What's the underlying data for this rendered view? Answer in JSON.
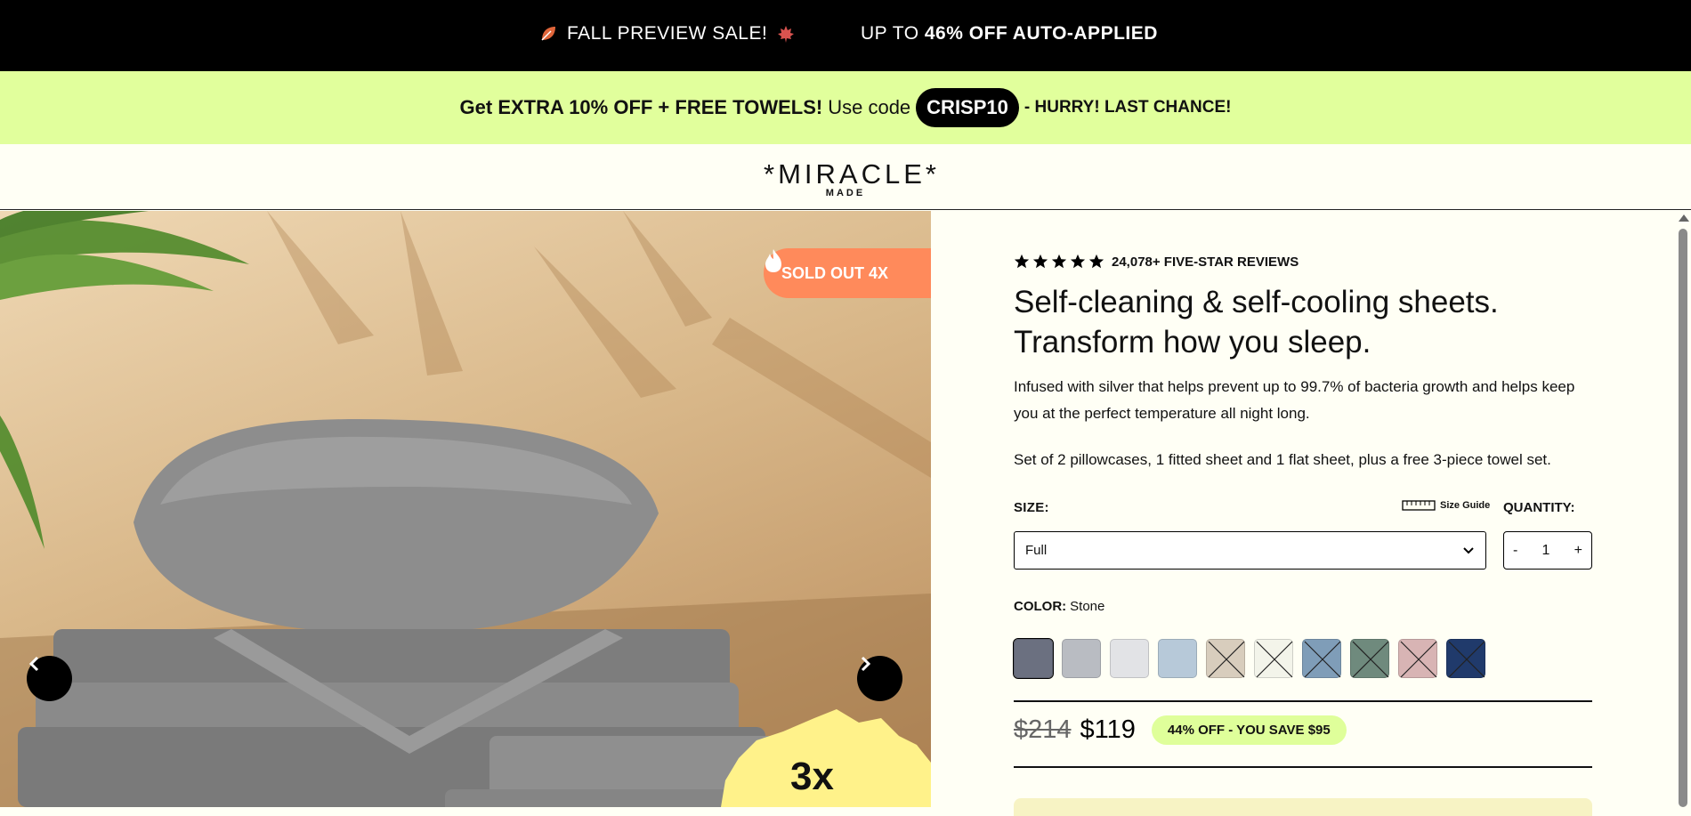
{
  "topbar": {
    "sale_text": "FALL PREVIEW SALE!",
    "up_to": "UP TO",
    "discount": "46% OFF AUTO-APPLIED"
  },
  "promo": {
    "part1": "Get EXTRA 10% OFF + FREE TOWELS!",
    "part2": "Use code",
    "code": "CRISP10",
    "part3": "- HURRY! LAST CHANCE!"
  },
  "brand": {
    "name": "*MIRACLE*",
    "sub": "MADE"
  },
  "gallery": {
    "badge": "SOLD OUT 4X",
    "sticker": "3x"
  },
  "product": {
    "reviews": "24,078+ FIVE-STAR REVIEWS",
    "title_line1": "Self-cleaning & self-cooling sheets.",
    "title_line2": "Transform how you sleep.",
    "description": "Infused with silver that helps prevent up to 99.7% of bacteria growth and helps keep you at the perfect temperature all night long.",
    "set": "Set of 2 pillowcases, 1 fitted sheet and 1 flat sheet, plus a free 3-piece towel set.",
    "size_label": "SIZE:",
    "size_guide": "Size Guide",
    "qty_label": "QUANTITY:",
    "size_value": "Full",
    "qty_minus": "-",
    "qty_value": "1",
    "qty_plus": "+",
    "color_label": "COLOR:",
    "color_value": "Stone",
    "old_price": "$214",
    "new_price": "$119",
    "save": "44% OFF - YOU SAVE $95"
  },
  "swatches": [
    {
      "color": "#6b7080",
      "available": true,
      "selected": true
    },
    {
      "color": "#b9bcc2",
      "available": true
    },
    {
      "color": "#e2e3e6",
      "available": true
    },
    {
      "color": "#b7c9d9",
      "available": true
    },
    {
      "color": "#d8cdbd",
      "available": false
    },
    {
      "color": "#f3f4ea",
      "available": false
    },
    {
      "color": "#7f9db8",
      "available": false
    },
    {
      "color": "#6f8a7d",
      "available": false
    },
    {
      "color": "#d8b4b4",
      "available": false
    },
    {
      "color": "#203a6b",
      "available": false
    }
  ]
}
